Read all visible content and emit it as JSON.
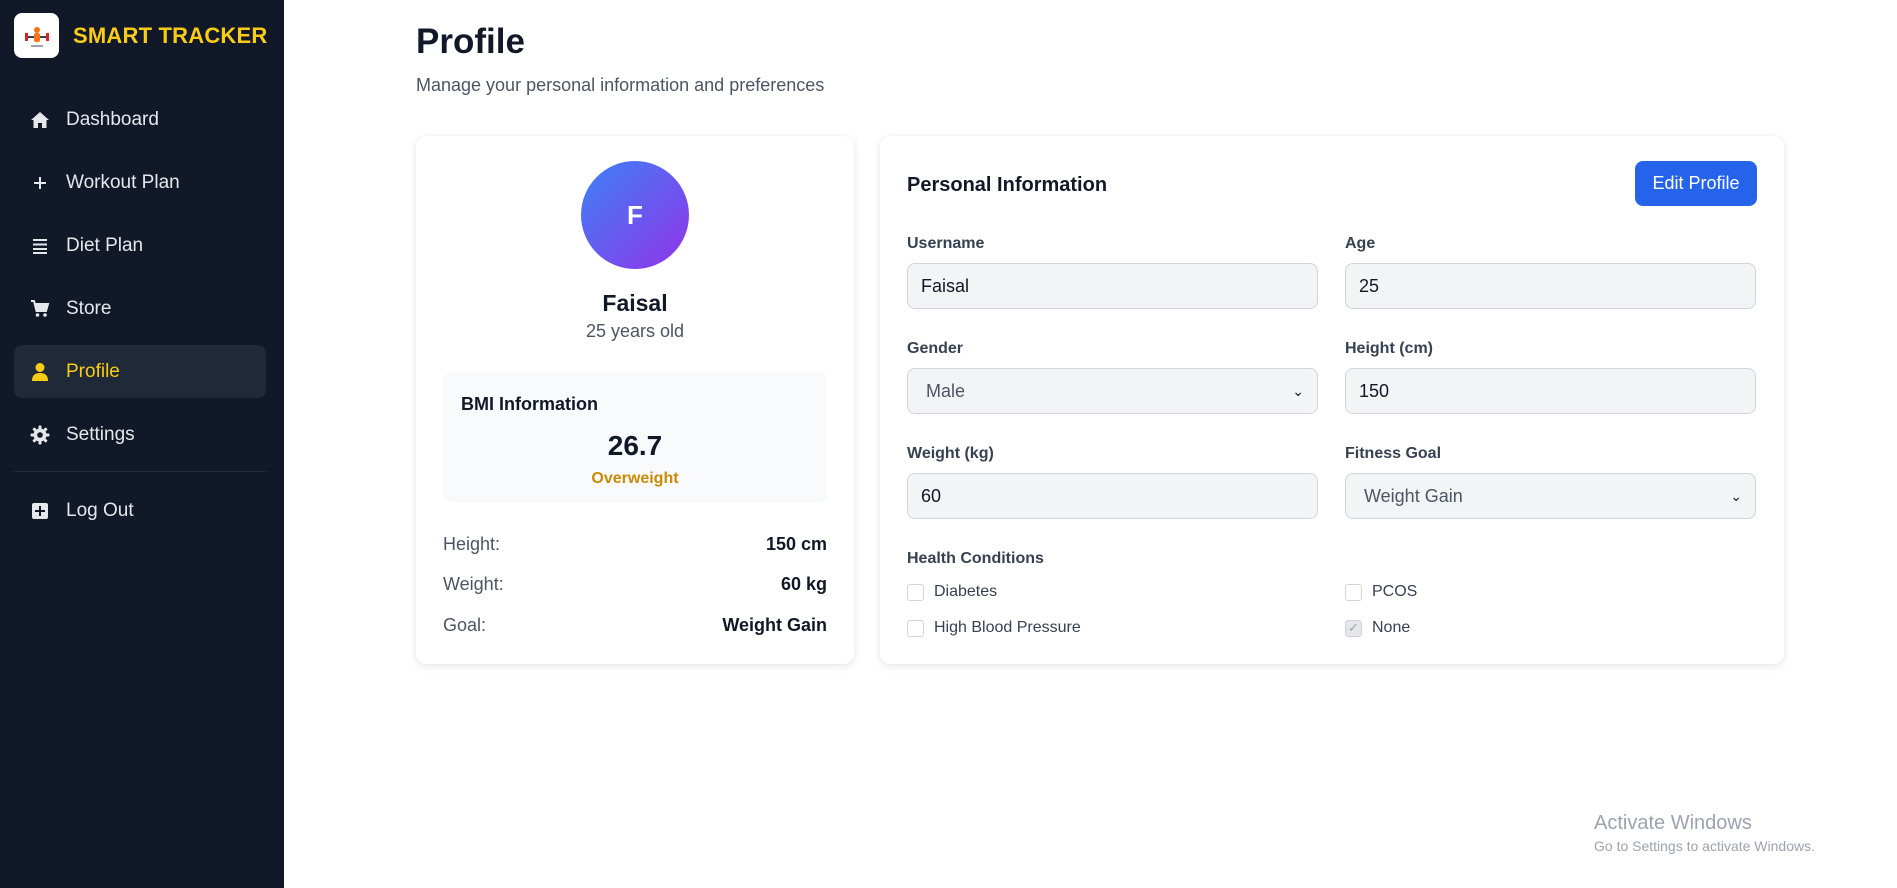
{
  "brand": {
    "name": "SMART TRACKER",
    "logo_icon": "dumbbell-logo-icon",
    "accent": "#facc15"
  },
  "sidebar": {
    "items": [
      {
        "label": "Dashboard",
        "icon": "home-icon",
        "active": false
      },
      {
        "label": "Workout Plan",
        "icon": "plus-icon",
        "active": false
      },
      {
        "label": "Diet Plan",
        "icon": "list-icon",
        "active": false
      },
      {
        "label": "Store",
        "icon": "cart-icon",
        "active": false
      },
      {
        "label": "Profile",
        "icon": "user-icon",
        "active": true
      },
      {
        "label": "Settings",
        "icon": "gear-icon",
        "active": false
      }
    ],
    "logout": {
      "label": "Log Out",
      "icon": "logout-icon"
    }
  },
  "header": {
    "title": "Profile",
    "subtitle": "Manage your personal information and preferences"
  },
  "profile_card": {
    "avatar_initial": "F",
    "name": "Faisal",
    "age_text": "25 years old",
    "bmi": {
      "title": "BMI Information",
      "value": "26.7",
      "status": "Overweight"
    },
    "stats": [
      {
        "label": "Height:",
        "value": "150 cm"
      },
      {
        "label": "Weight:",
        "value": "60 kg"
      },
      {
        "label": "Goal:",
        "value": "Weight Gain"
      }
    ]
  },
  "info_card": {
    "title": "Personal Information",
    "edit_label": "Edit Profile",
    "fields": {
      "username": {
        "label": "Username",
        "value": "Faisal"
      },
      "age": {
        "label": "Age",
        "value": "25"
      },
      "gender": {
        "label": "Gender",
        "value": "Male"
      },
      "height": {
        "label": "Height (cm)",
        "value": "150"
      },
      "weight": {
        "label": "Weight (kg)",
        "value": "60"
      },
      "goal": {
        "label": "Fitness Goal",
        "value": "Weight Gain"
      }
    },
    "health": {
      "label": "Health Conditions",
      "options": [
        {
          "label": "Diabetes",
          "checked": false
        },
        {
          "label": "PCOS",
          "checked": false
        },
        {
          "label": "High Blood Pressure",
          "checked": false
        },
        {
          "label": "None",
          "checked": true
        }
      ]
    }
  },
  "watermark": {
    "line1": "Activate Windows",
    "line2": "Go to Settings to activate Windows."
  }
}
